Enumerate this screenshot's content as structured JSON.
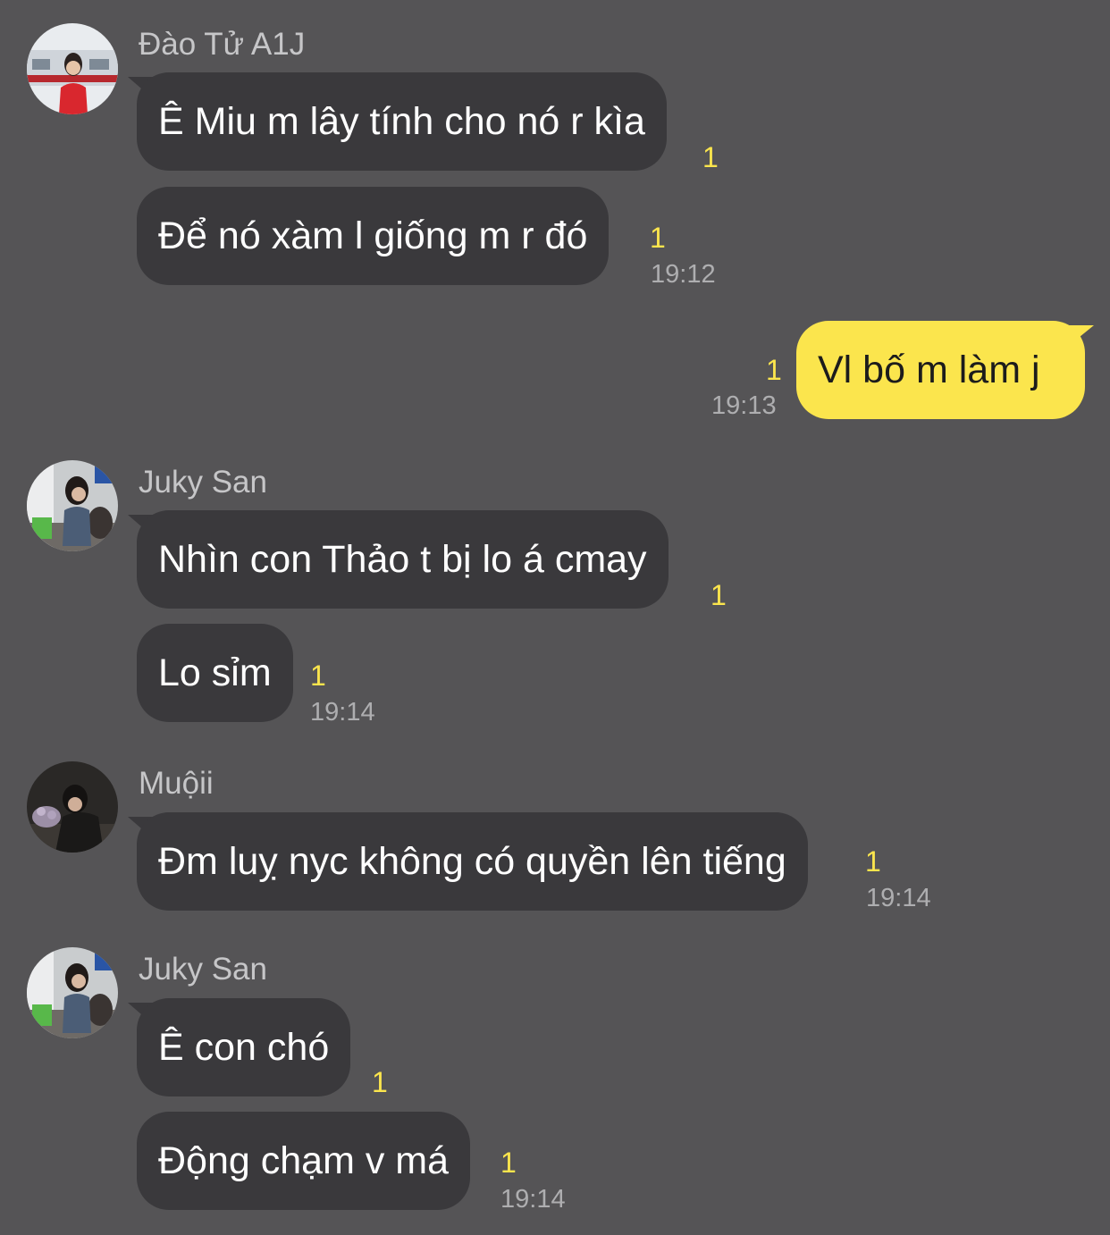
{
  "chat": {
    "groups": [
      {
        "sender": "Đào Tử A1J",
        "avatar_icon": "user-avatar-icon",
        "messages": [
          {
            "text": "Ê Miu m lây tính cho nó r kìa",
            "unread": "1"
          },
          {
            "text": "Để nó xàm l giống m r đó",
            "unread": "1",
            "time": "19:12"
          }
        ]
      },
      {
        "sender": "",
        "own": true,
        "messages": [
          {
            "text": "Vl bố m làm j",
            "unread": "1",
            "time": "19:13"
          }
        ]
      },
      {
        "sender": "Juky San",
        "avatar_icon": "user-avatar-icon",
        "messages": [
          {
            "text": "Nhìn con Thảo t bị lo á cmay",
            "unread": "1"
          },
          {
            "text": "Lo sỉm",
            "unread": "1",
            "time": "19:14"
          }
        ]
      },
      {
        "sender": "Muộii",
        "avatar_icon": "user-avatar-icon",
        "messages": [
          {
            "text": "Đm luỵ nyc không có quyền lên tiếng",
            "unread": "1",
            "time": "19:14"
          }
        ]
      },
      {
        "sender": "Juky San",
        "avatar_icon": "user-avatar-icon",
        "messages": [
          {
            "text": "Ê con chó",
            "unread": "1"
          },
          {
            "text": "Động chạm v má",
            "unread": "1",
            "time": "19:14"
          }
        ]
      }
    ]
  },
  "colors": {
    "background": "#555456",
    "incoming_bubble": "#3a393c",
    "outgoing_bubble": "#fbe54d",
    "unread_count": "#fbe54d",
    "timestamp": "#aeaeb0",
    "sender_name": "#c6c6c8"
  }
}
